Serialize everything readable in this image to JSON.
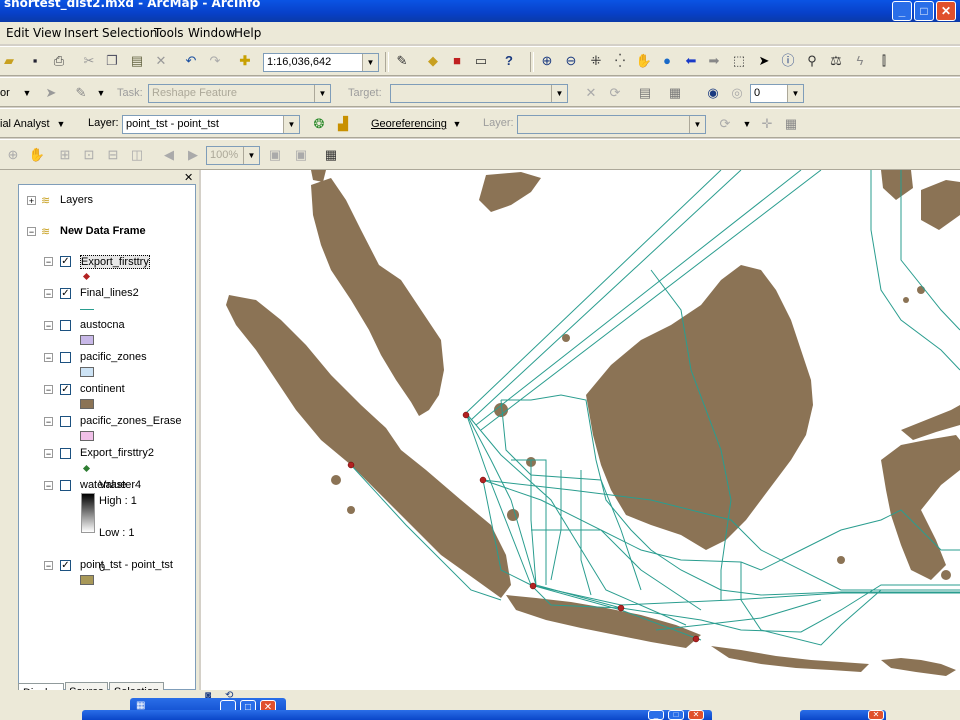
{
  "window": {
    "title": "shortest_dist2.mxd - ArcMap - ArcInfo",
    "minimize": "_",
    "maximize": "□",
    "close": "✕"
  },
  "menu": [
    "Edit",
    "View",
    "Insert",
    "Selection",
    "Tools",
    "Window",
    "Help"
  ],
  "standard_toolbar": {
    "scale_value": "1:16,036,642"
  },
  "editor_toolbar": {
    "editor_label": "or",
    "task_label": "Task:",
    "task_value": "Reshape Feature",
    "target_label": "Target:",
    "target_value": "",
    "number_value": "0"
  },
  "spatial_toolbar": {
    "spatial_label": "ial Analyst",
    "layer_label": "Layer:",
    "layer_value": "point_tst - point_tst",
    "georef_label": "Georeferencing",
    "georef_layer_label": "Layer:",
    "georef_layer_value": ""
  },
  "layout_toolbar": {
    "zoom_percent": "100%"
  },
  "toc": {
    "root_label": "Layers",
    "data_frame": "New Data Frame",
    "layers": [
      {
        "name": "Export_firsttry",
        "checked": true,
        "swatch": "dot",
        "color": "#b22222"
      },
      {
        "name": "Final_lines2",
        "checked": true,
        "swatch": "line",
        "color": "#2a9d8f"
      },
      {
        "name": "austocna",
        "checked": false,
        "swatch": "fill",
        "color": "#c8b8e8"
      },
      {
        "name": "pacific_zones",
        "checked": false,
        "swatch": "fill",
        "color": "#cde3f5"
      },
      {
        "name": "continent",
        "checked": true,
        "swatch": "fill",
        "color": "#8b7355"
      },
      {
        "name": "pacific_zones_Erase",
        "checked": false,
        "swatch": "fill",
        "color": "#f0c0e8"
      },
      {
        "name": "Export_firsttry2",
        "checked": false,
        "swatch": "dot",
        "color": "#2e7d32"
      },
      {
        "name": "waterraster4",
        "checked": false,
        "swatch": "none",
        "color": ""
      },
      {
        "name": "point_tst - point_tst",
        "checked": true,
        "swatch": "fill",
        "color": "#a89858"
      }
    ],
    "raster_legend": {
      "title": "Value",
      "high": "High : 1",
      "low": "Low : 1"
    },
    "point_tst_class": "0",
    "tabs": [
      "Display",
      "Source",
      "Selection"
    ]
  },
  "colors": {
    "land": "#8b7355",
    "route": "#2a9d8f",
    "point": "#b22222"
  }
}
